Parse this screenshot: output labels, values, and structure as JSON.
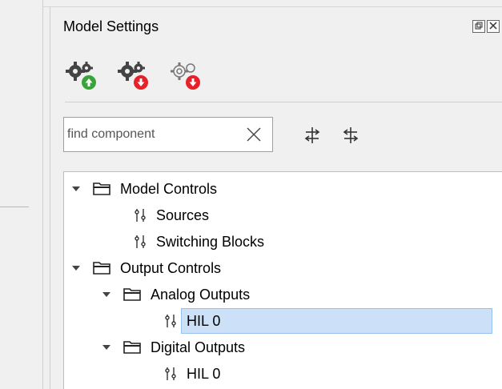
{
  "panel": {
    "title": "Model Settings",
    "float_icon": "float-icon",
    "close_icon": "close-icon"
  },
  "toolbar": {
    "buttons": [
      {
        "icon": "gears-upload-icon",
        "badge_color": "#3aa33a"
      },
      {
        "icon": "gears-download-icon",
        "badge_color": "#e8202a"
      },
      {
        "icon": "gears-download-outline-icon",
        "badge_color": "#e8202a"
      }
    ]
  },
  "search": {
    "placeholder": "find component",
    "value": "",
    "clear_icon": "clear-icon"
  },
  "tree_actions": {
    "expand_icon": "expand-all-icon",
    "collapse_icon": "collapse-all-icon"
  },
  "tree": {
    "items": [
      {
        "label": "Model Controls",
        "type": "folder",
        "expanded": true
      },
      {
        "label": "Sources",
        "type": "item"
      },
      {
        "label": "Switching Blocks",
        "type": "item"
      },
      {
        "label": "Output Controls",
        "type": "folder",
        "expanded": true
      },
      {
        "label": "Analog Outputs",
        "type": "folder",
        "expanded": true
      },
      {
        "label": "HIL 0",
        "type": "item",
        "selected": true
      },
      {
        "label": "Digital Outputs",
        "type": "folder",
        "expanded": true
      },
      {
        "label": "HIL 0",
        "type": "item"
      }
    ]
  },
  "colors": {
    "selection": "#cce0f7",
    "green_badge": "#3aa33a",
    "red_badge": "#e8202a"
  }
}
